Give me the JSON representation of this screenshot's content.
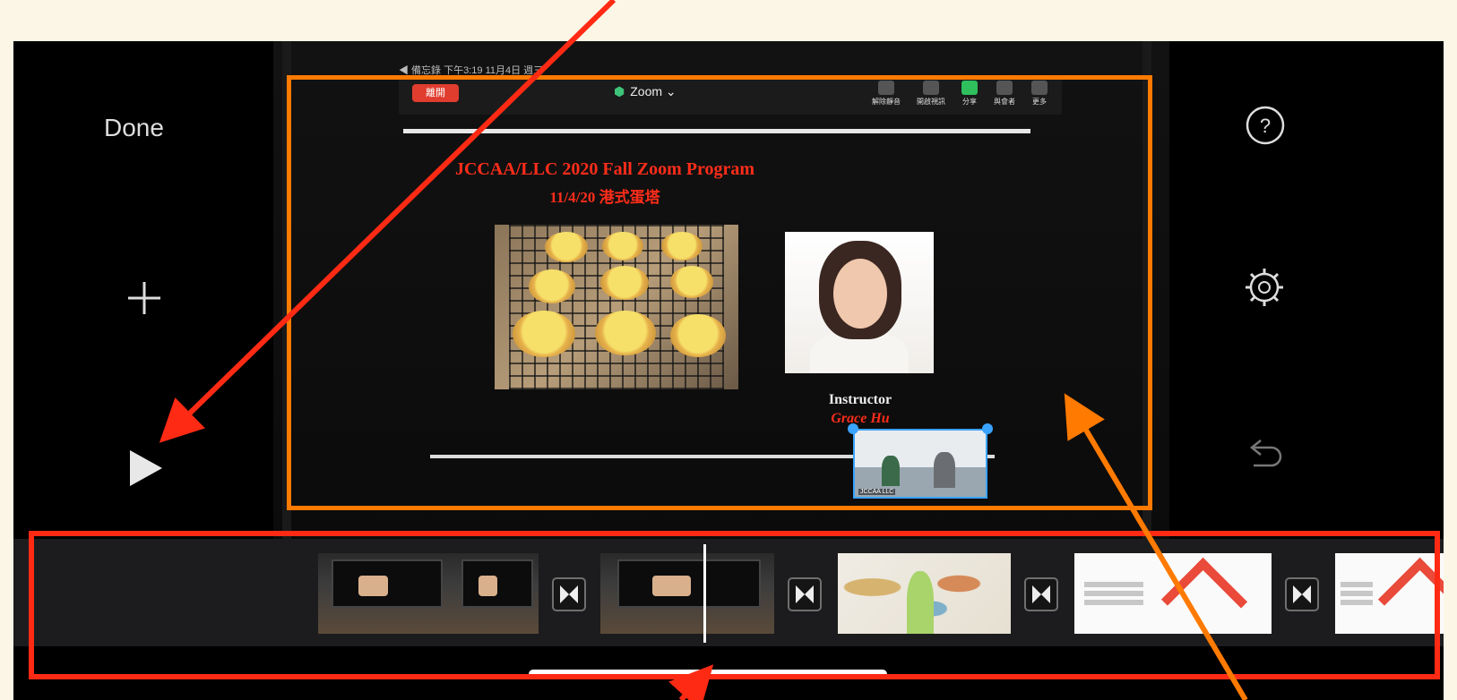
{
  "controls": {
    "done_label": "Done",
    "add_icon": "plus-icon",
    "play_icon": "play-icon",
    "help_icon": "question-circle-icon",
    "settings_icon": "gear-icon",
    "undo_icon": "undo-icon"
  },
  "preview": {
    "status_text": "◀ 備忘錄 下午3:19 11月4日 週三",
    "zoom_leave_label": "離開",
    "zoom_title": "Zoom ⌄",
    "zoom_toolbar": [
      {
        "label": "解除靜音"
      },
      {
        "label": "開啟視訊"
      },
      {
        "label": "分享"
      },
      {
        "label": "與會者"
      },
      {
        "label": "更多"
      }
    ],
    "slide_title": "JCCAA/LLC 2020 Fall Zoom Program",
    "slide_subtitle": "11/4/20 港式蛋塔",
    "instructor_label": "Instructor",
    "instructor_name": "Grace Hu",
    "pip_label": "JCCAA LLC"
  },
  "annotations": {
    "orange": "#ff7a00",
    "red": "#ff2a14"
  },
  "timeline": {
    "clips": [
      "zoom-meeting",
      "zoom-meeting",
      "zoom-meeting",
      "world-map",
      "yoga-slide",
      "text-slide"
    ],
    "transition_icon": "bowtie-transition-icon"
  }
}
